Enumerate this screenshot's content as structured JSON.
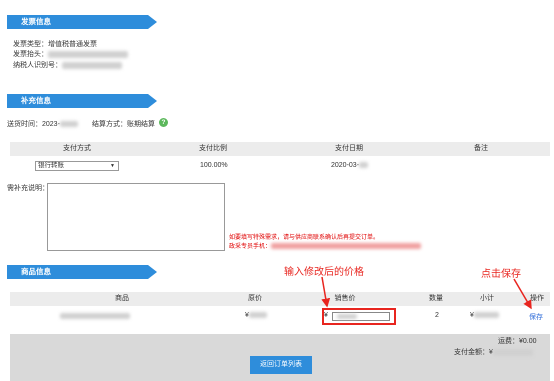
{
  "invoice": {
    "header": "发票信息",
    "type_line": "发票类型：增值税普通发票",
    "title_label": "发票抬头：",
    "taxid_label": "纳税人识别号："
  },
  "supplement": {
    "header": "补充信息",
    "delivery_label": "送货时间：2023-",
    "settlement": "结算方式：账期结算",
    "help_icon": "?"
  },
  "payment_table": {
    "columns": [
      "支付方式",
      "支付比例",
      "支付日期",
      "备注"
    ],
    "row": {
      "method": "银行转账",
      "ratio": "100.00%",
      "date": "2020-03-"
    }
  },
  "remarks": {
    "label": "需补充说明：",
    "warning_line1": "如要填写特殊需求，请与供应商联系确认后再提交订单。",
    "warning_line2": "政采专员手机："
  },
  "products": {
    "header": "商品信息",
    "columns": [
      "商品",
      "原价",
      "销售价",
      "数量",
      "小计",
      "操作"
    ],
    "row": {
      "price_prefix": "¥",
      "sale_prefix": "¥",
      "quantity": "2",
      "subtotal_prefix": "¥",
      "action": "保存"
    }
  },
  "annotations": {
    "input_hint": "输入修改后的价格",
    "save_hint": "点击保存"
  },
  "footer": {
    "shipping": "运费：¥0.00",
    "total_label": "支付金额：¥",
    "back_button": "返回订单列表"
  },
  "colors": {
    "accent": "#2e8ddb",
    "annotation": "#e8251f",
    "warning": "#e00000",
    "link": "#2e6bd8"
  }
}
